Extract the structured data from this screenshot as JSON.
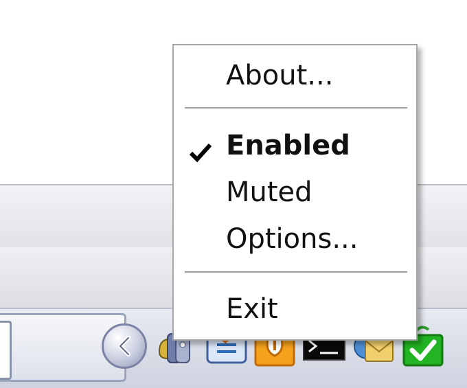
{
  "context_menu": {
    "items": [
      {
        "label": "About...",
        "checked": false,
        "bold": false
      },
      {
        "label": "Enabled",
        "checked": true,
        "bold": true
      },
      {
        "label": "Muted",
        "checked": false,
        "bold": false
      },
      {
        "label": "Options...",
        "checked": false,
        "bold": false
      },
      {
        "label": "Exit",
        "checked": false,
        "bold": false
      }
    ]
  },
  "tray_icons": [
    "show-hidden-icons-chevron-icon",
    "volume-icon",
    "network-icon",
    "orange-app-icon",
    "terminal-icon",
    "mail-icon",
    "green-check-icon"
  ],
  "colors": {
    "menu_border": "#a7a7a7",
    "taskbar": "#cdd2df",
    "text": "#111111"
  }
}
